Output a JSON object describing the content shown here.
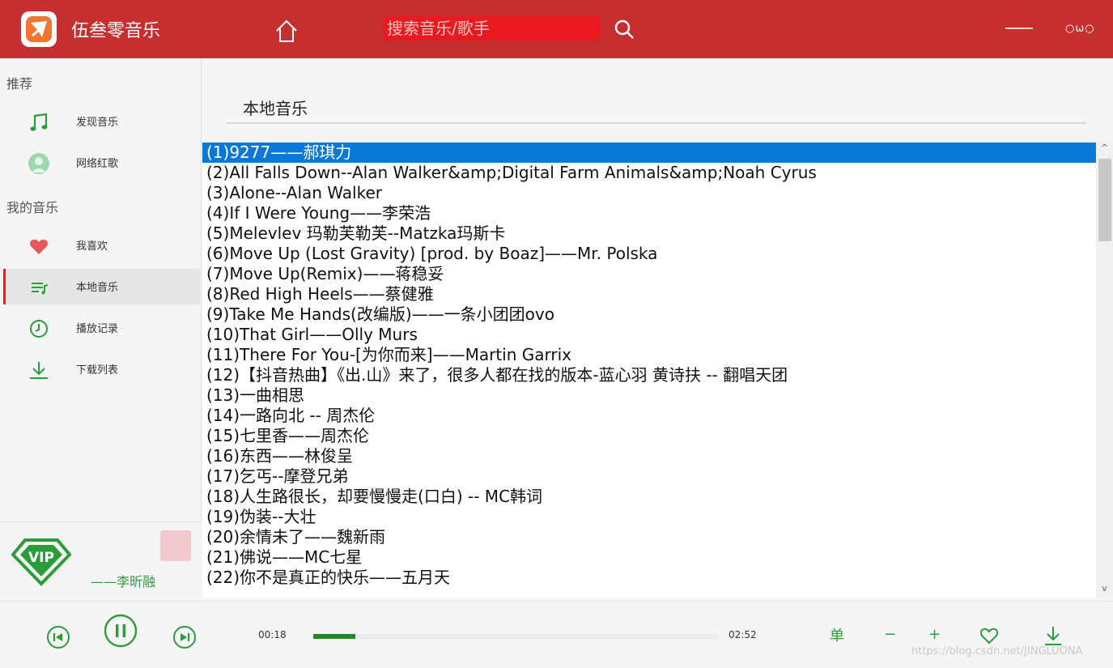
{
  "app": {
    "title": "伍叁零音乐"
  },
  "search": {
    "placeholder": "搜索音乐/歌手"
  },
  "window_controls": {
    "more_label": "○ω○"
  },
  "sidebar": {
    "sections": [
      {
        "title": "推荐",
        "items": [
          {
            "label": "发现音乐",
            "icon": "music-note-icon"
          },
          {
            "label": "网络红歌",
            "icon": "user-icon"
          }
        ]
      },
      {
        "title": "我的音乐",
        "items": [
          {
            "label": "我喜欢",
            "icon": "heart-icon"
          },
          {
            "label": "本地音乐",
            "icon": "playlist-icon"
          },
          {
            "label": "播放记录",
            "icon": "clock-icon"
          },
          {
            "label": "下载列表",
            "icon": "download-icon"
          }
        ]
      }
    ],
    "user": {
      "vip_label": "VIP",
      "name": "——李昕融"
    }
  },
  "main": {
    "title": "本地音乐",
    "selected_index": 0,
    "songs": [
      "(1)9277——郝琪力",
      "(2)All Falls Down--Alan Walker&amp;Digital Farm Animals&amp;Noah Cyrus",
      "(3)Alone--Alan Walker",
      "(4)If I Were Young——李荣浩",
      "(5)Melevlev 玛勒芙勒芙--Matzka玛斯卡",
      "(6)Move Up (Lost Gravity) [prod. by Boaz]——Mr. Polska",
      "(7)Move Up(Remix)——蒋稳妥",
      "(8)Red High Heels——蔡健雅",
      "(9)Take Me Hands(改编版)——一条小团团ovo",
      "(10)That Girl——Olly Murs",
      "(11)There For You-[为你而来]——Martin Garrix",
      "(12)【抖音热曲】《出.山》来了，很多人都在找的版本-蓝心羽 黄诗扶 -- 翻唱天团",
      "(13)一曲相思",
      "(14)一路向北 -- 周杰伦",
      "(15)七里香——周杰伦",
      "(16)东西——林俊呈",
      "(17)乞丐--摩登兄弟",
      "(18)人生路很长，却要慢慢走(口白) -- MC韩词",
      "(19)伪装--大壮",
      "(20)余情未了——魏新雨",
      "(21)佛说——MC七星",
      "(22)你不是真正的快乐——五月天"
    ]
  },
  "player": {
    "current_time": "00:18",
    "total_time": "02:52",
    "progress": 0.104,
    "mode_label": "单",
    "volume_down_label": "−",
    "volume_up_label": "+",
    "watermark": "https://blog.csdn.net/JINGLUONA"
  },
  "colors": {
    "brand": "#c62f2f",
    "accent": "#2a9d3a",
    "selection": "#0a78d7",
    "search_bg": "#e81a1f"
  }
}
